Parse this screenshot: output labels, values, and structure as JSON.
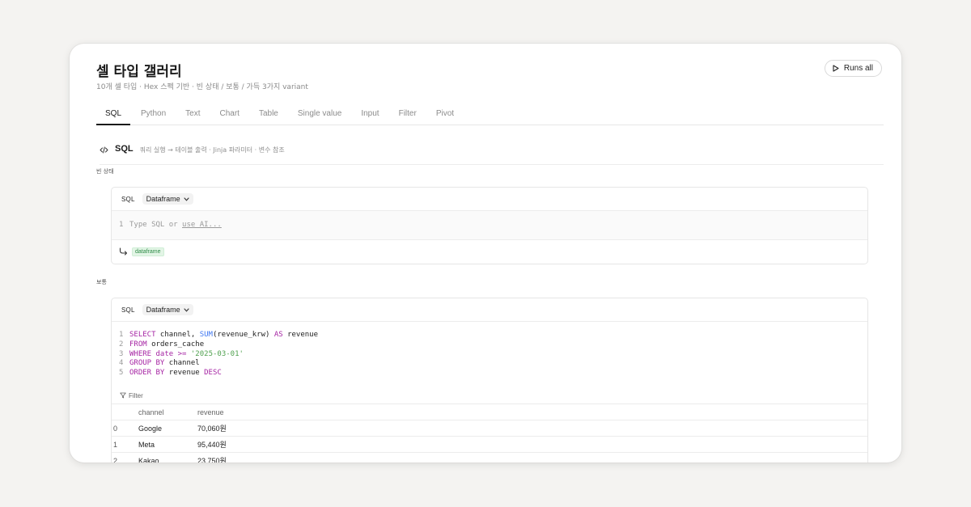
{
  "header": {
    "title": "셀 타입 갤러리",
    "subtitle": "10개 셀 타입 · Hex 스펙 기반 · 빈 상태 / 보통 / 가득 3가지 variant",
    "runs_all": "Runs all"
  },
  "tabs": [
    "SQL",
    "Python",
    "Text",
    "Chart",
    "Table",
    "Single value",
    "Input",
    "Filter",
    "Pivot"
  ],
  "section": {
    "title": "SQL",
    "desc": "쿼리 실행 → 테이블 출력 · Jinja 파라미터 · 변수 참조"
  },
  "variants": {
    "empty": "빈 상태",
    "normal": "보통"
  },
  "cell_empty": {
    "type": "SQL",
    "output_type": "Dataframe",
    "line_no": "1",
    "placeholder": "Type SQL or",
    "ai_link": "use AI...",
    "output_var": "dataframe"
  },
  "cell_normal": {
    "type": "SQL",
    "output_type": "Dataframe",
    "lines": [
      {
        "n": "1",
        "tokens": [
          [
            "kw",
            "SELECT"
          ],
          [
            "t",
            " channel, "
          ],
          [
            "fn",
            "SUM"
          ],
          [
            "t",
            "(revenue_krw) "
          ],
          [
            "kw",
            "AS"
          ],
          [
            "t",
            " revenue"
          ]
        ]
      },
      {
        "n": "2",
        "tokens": [
          [
            "kw",
            "FROM"
          ],
          [
            "t",
            " orders_cache"
          ]
        ]
      },
      {
        "n": "3",
        "tokens": [
          [
            "kw",
            "WHERE"
          ],
          [
            "t",
            " "
          ],
          [
            "kw",
            "date"
          ],
          [
            "t",
            " "
          ],
          [
            "kw",
            ">="
          ],
          [
            "t",
            " "
          ],
          [
            "str",
            "'2025-03-01'"
          ]
        ]
      },
      {
        "n": "4",
        "tokens": [
          [
            "kw",
            "GROUP BY"
          ],
          [
            "t",
            " channel"
          ]
        ]
      },
      {
        "n": "5",
        "tokens": [
          [
            "kw",
            "ORDER BY"
          ],
          [
            "t",
            " revenue "
          ],
          [
            "kw",
            "DESC"
          ]
        ]
      }
    ],
    "filter_label": "Filter",
    "columns": [
      "channel",
      "revenue"
    ],
    "rows": [
      {
        "idx": "0",
        "channel": "Google",
        "revenue": "70,060원"
      },
      {
        "idx": "1",
        "channel": "Meta",
        "revenue": "95,440원"
      },
      {
        "idx": "2",
        "channel": "Kakao",
        "revenue": "23,750원"
      }
    ]
  },
  "colors": {
    "keyword": "#a626a4",
    "function": "#4078f2",
    "string": "#50a14f",
    "tag_bg": "#e3f5e6",
    "tag_fg": "#2e8b47"
  },
  "icons": {
    "runs_all": "play-icon",
    "section": "code-icon",
    "dropdown": "chevron-down-icon",
    "output": "return-arrow-icon",
    "filter": "filter-icon"
  }
}
